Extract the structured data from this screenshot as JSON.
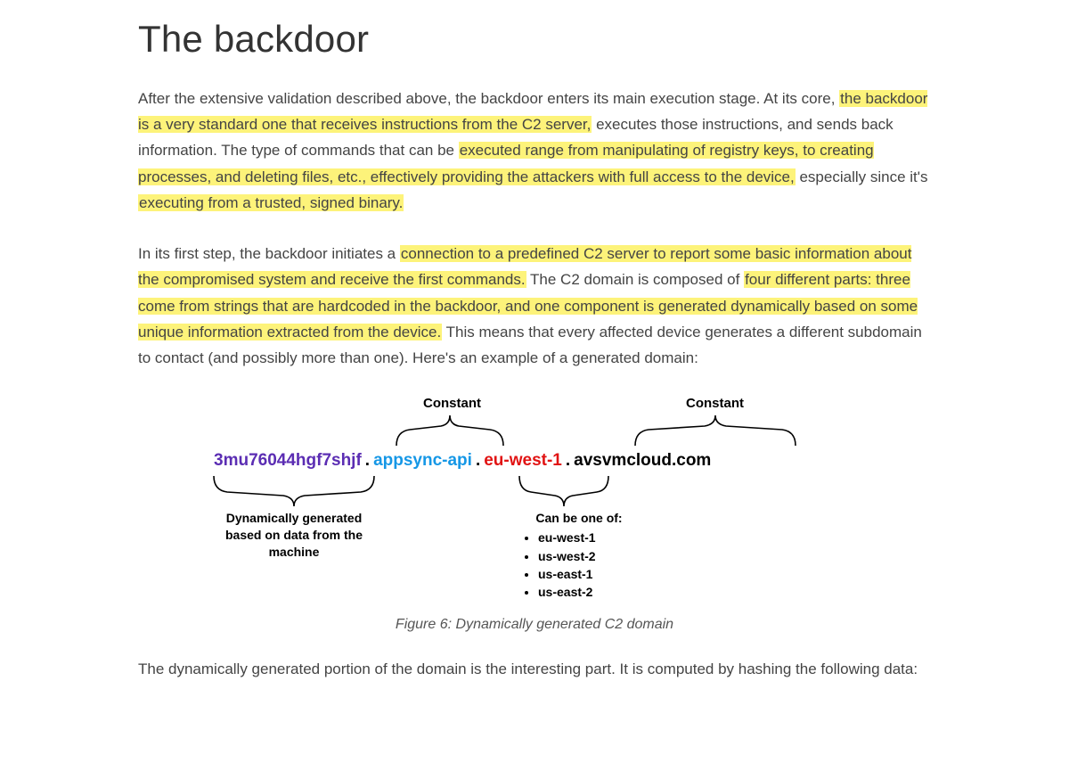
{
  "heading": "The backdoor",
  "p1": {
    "s1": "After the extensive validation described above, the backdoor enters its main execution stage. At its core, ",
    "h1": "the backdoor is a very standard one that receives instructions from the C2 server,",
    "s2": " executes those instructions, and sends back information. The type of commands that can be ",
    "h2": "executed range from manipulating of registry keys, to creating processes, and deleting files, etc., effectively providing the attackers with full access to the device,",
    "s3": " especially since it's ",
    "h3": "executing from a trusted, signed binary.",
    "s4": ""
  },
  "p2": {
    "s1": "In its first step, the backdoor initiates a ",
    "h1": "connection to a predefined C2 server to report some basic information about the compromised system and receive the first commands.",
    "s2": " The C2 domain is composed of ",
    "h2": "four different parts: three come from strings that are hardcoded in the backdoor, and one component is generated dynamically based on some unique information extracted from the device.",
    "s3": " This means that every affected device generates a different subdomain to contact (and possibly more than one). Here's an example of a generated domain:"
  },
  "figure": {
    "constant_label": "Constant",
    "segments": {
      "dynamic": "3mu76044hgf7shjf",
      "app": "appsync-api",
      "region": "eu-west-1",
      "root": "avsvmcloud.com"
    },
    "dyn_caption": "Dynamically generated based on data from the machine",
    "region_head": "Can be one of:",
    "regions": [
      "eu-west-1",
      "us-west-2",
      "us-east-1",
      "us-east-2"
    ],
    "caption": "Figure 6: Dynamically generated C2 domain"
  },
  "p3": "The dynamically generated portion of the domain is the interesting part. It is computed by hashing the following data:"
}
